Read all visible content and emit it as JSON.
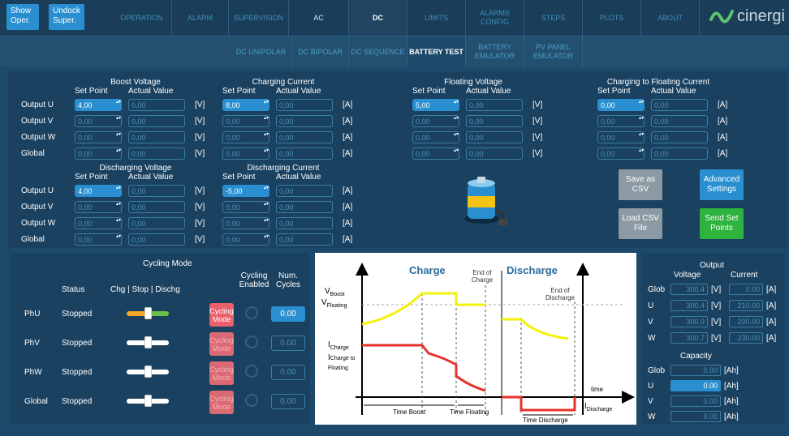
{
  "topbar": {
    "show_oper": "Show Oper.",
    "undock_super": "Undock Super.",
    "tabs": [
      "OPERATION",
      "ALARM",
      "SUPERVISION",
      "AC",
      "DC",
      "LIMITS",
      "ALARMS CONFIG",
      "STEPS",
      "PLOTS",
      "ABOUT"
    ],
    "selected_tab": "DC",
    "logo_text": "cinergi"
  },
  "subtabs": {
    "items": [
      "DC UNIPOLAR",
      "DC BIPOLAR",
      "DC SEQUENCE",
      "BATTERY TEST",
      "BATTERY EMULATOR",
      "PV PANEL EMULATOR"
    ],
    "selected": "BATTERY TEST"
  },
  "labels": {
    "set_point": "Set Point",
    "actual_value": "Actual Value",
    "rows": [
      "Output U",
      "Output V",
      "Output W",
      "Global"
    ]
  },
  "groups": {
    "boost_voltage": {
      "title": "Boost Voltage",
      "unit": "[V]",
      "set": [
        "4,00",
        "0,00",
        "0,00",
        "0,00"
      ],
      "actual": [
        "0,00",
        "0,00",
        "0,00",
        "0,00"
      ]
    },
    "charging_current": {
      "title": "Charging Current",
      "unit": "[A]",
      "set": [
        "8,00",
        "0,00",
        "0,00",
        "0,00"
      ],
      "actual": [
        "0,00",
        "0,00",
        "0,00",
        "0,00"
      ]
    },
    "floating_voltage": {
      "title": "Floating Voltage",
      "unit": "[V]",
      "set": [
        "5,00",
        "0,00",
        "0,00",
        "0,00"
      ],
      "actual": [
        "0,00",
        "0,00",
        "0,00",
        "0,00"
      ]
    },
    "charging_to_floating_current": {
      "title": "Charging to Floating Current",
      "unit": "[A]",
      "set": [
        "0,00",
        "0,00",
        "0,00",
        "0,00"
      ],
      "actual": [
        "0,00",
        "0,00",
        "0,00",
        "0,00"
      ]
    },
    "discharging_voltage": {
      "title": "Discharging Voltage",
      "unit": "[V]",
      "set": [
        "4,00",
        "0,00",
        "0,00",
        "0,00"
      ],
      "actual": [
        "0,00",
        "0,00",
        "0,00",
        "0,00"
      ]
    },
    "discharging_current": {
      "title": "Discharging Current",
      "unit": "[A]",
      "set": [
        "-5,00",
        "0,00",
        "0,00",
        "0,00"
      ],
      "actual": [
        "0,00",
        "0,00",
        "0,00",
        "0,00"
      ]
    }
  },
  "buttons": {
    "save_csv": "Save as CSV",
    "advanced_settings": "Advanced Settings",
    "load_csv": "Load CSV File",
    "send_set_points": "Send Set Points"
  },
  "cycling": {
    "title": "Cycling Mode",
    "status_header": "Status",
    "mode_header": "Chg | Stop | Dischg",
    "enabled_header": "Cycling Enabled",
    "num_cycles_header": "Num. Cycles",
    "mode_button": "Cycling Mode",
    "rows": [
      {
        "name": "PhU",
        "status": "Stopped",
        "cycles": "0.00",
        "slider_level": 0.5
      },
      {
        "name": "PhV",
        "status": "Stopped",
        "cycles": "0.00",
        "slider_level": 0.5
      },
      {
        "name": "PhW",
        "status": "Stopped",
        "cycles": "0.00",
        "slider_level": 0.5
      },
      {
        "name": "Global",
        "status": "Stopped",
        "cycles": "0.00",
        "slider_level": 0.5
      }
    ]
  },
  "diagram": {
    "charge": "Charge",
    "discharge": "Discharge",
    "end_of_charge": "End of Charge",
    "end_of_discharge": "End of Discharge",
    "v_boost": "V",
    "v_boost_sub": "Boost",
    "v_floating": "V",
    "v_floating_sub": "Floating",
    "i_charge": "I",
    "i_charge_sub": "Charge",
    "i_c2f": "I",
    "i_c2f_sub": "Charge to",
    "i_c2f_sub2": "Floating",
    "time": "time",
    "i_discharge": "I",
    "i_discharge_sub": "Discharge",
    "time_boost": "Time Boost",
    "time_floating": "Time Floating",
    "time_discharge": "Time Discharge",
    "voltage_color": "#f2f20a",
    "current_color": "#e8312b"
  },
  "output": {
    "title": "Output",
    "voltage": "Voltage",
    "current": "Current",
    "rows": [
      {
        "name": "Glob",
        "v": "300.4",
        "i": "0.00"
      },
      {
        "name": "U",
        "v": "300.4",
        "i": "210.00"
      },
      {
        "name": "V",
        "v": "300.9",
        "i": "200.00"
      },
      {
        "name": "W",
        "v": "300.7",
        "i": "230.00"
      }
    ],
    "v_unit": "[V]",
    "i_unit": "[A]",
    "capacity_title": "Capacity",
    "capacity": [
      {
        "name": "Glob",
        "val": "0.00"
      },
      {
        "name": "U",
        "val": "0.00"
      },
      {
        "name": "V",
        "val": "0.00"
      },
      {
        "name": "W",
        "val": "0.00"
      }
    ],
    "cap_unit": "[Ah]"
  }
}
